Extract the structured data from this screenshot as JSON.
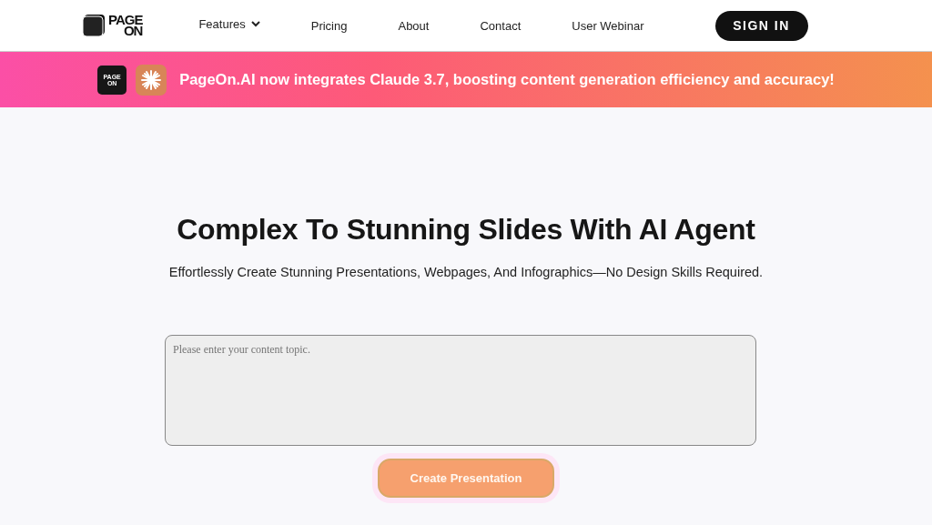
{
  "header": {
    "logo": {
      "line_1": "PAGE",
      "line_2": "ON"
    },
    "nav": [
      {
        "label": "Features",
        "kind": "dropdown"
      },
      {
        "label": "Pricing",
        "kind": "link"
      },
      {
        "label": "About",
        "kind": "link"
      },
      {
        "label": "Contact",
        "kind": "link"
      },
      {
        "label": "User Webinar",
        "kind": "link"
      }
    ],
    "sign_in": "SIGN IN"
  },
  "banner": {
    "logo": {
      "line_1": "PAGE",
      "line_2": "ON"
    },
    "text": "PageOn.AI now integrates Claude 3.7, boosting content generation efficiency and accuracy!"
  },
  "hero": {
    "title": "Complex To Stunning Slides With AI Agent",
    "subtitle": "Effortlessly Create Stunning Presentations, Webpages, And Infographics—No Design Skills Required.",
    "topic_field": {
      "placeholder": "Please enter your content topic."
    },
    "button": "Create Presentation"
  }
}
